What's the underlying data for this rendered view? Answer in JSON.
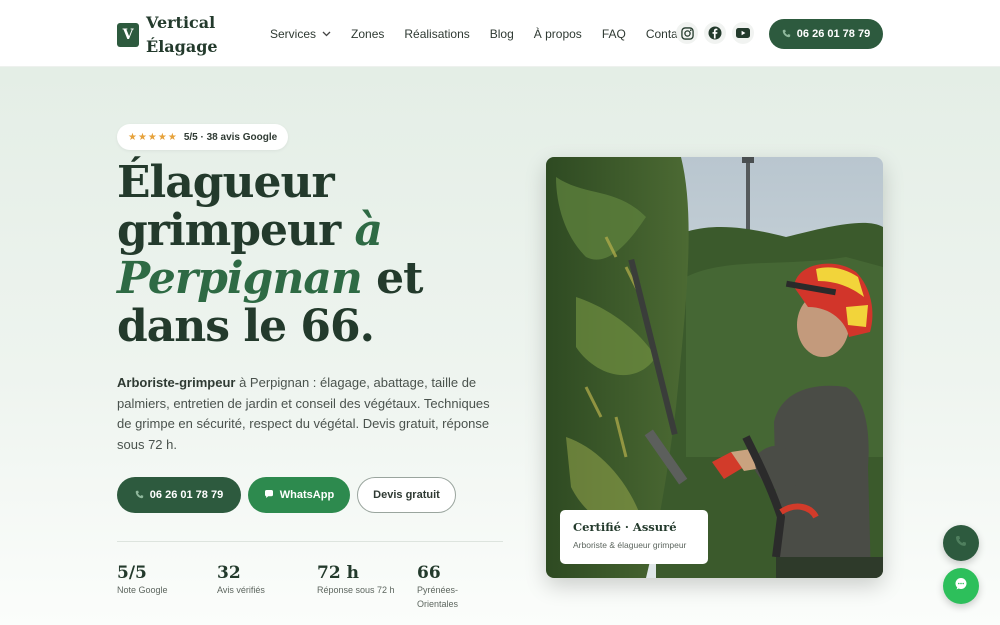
{
  "brand": {
    "mark": "V",
    "line1": "Vertical",
    "line2": "Élagage"
  },
  "nav": {
    "items": [
      "Services",
      "Zones",
      "Réalisations",
      "Blog",
      "À propos",
      "FAQ",
      "Contact"
    ]
  },
  "header_phone": "06 26 01 78 79",
  "hero": {
    "rating_stars": "★★★★★",
    "rating_text": "5/5 · 38 avis Google",
    "title_1": "Élagueur",
    "title_2": "grimpeur",
    "title_3": "à",
    "title_4": "Perpignan",
    "title_5": "et",
    "title_6": "dans le 66.",
    "lead_bold": "Arboriste-grimpeur",
    "lead_rest": " à Perpignan : élagage, abattage, taille de palmiers, entretien de jardin et conseil des végétaux. Techniques de grimpe en sécurité, respect du végétal. Devis gratuit, réponse sous 72 h.",
    "btn_phone": "06 26 01 78 79",
    "btn_whatsapp": "WhatsApp",
    "btn_devis": "Devis gratuit",
    "stats": [
      {
        "value": "5/5",
        "label": "Note Google"
      },
      {
        "value": "32",
        "label": "Avis vérifiés"
      },
      {
        "value": "72 h",
        "label": "Réponse sous 72 h"
      },
      {
        "value": "66",
        "label": "Pyrénées-Orientales"
      }
    ],
    "cert_title": "Certifié · Assuré",
    "cert_sub": "Arboriste & élagueur grimpeur"
  },
  "colors": {
    "primary": "#2d5a3e",
    "accent_green": "#2d8a4e",
    "chat_green": "#2dbf5b",
    "star": "#e6a23c"
  }
}
